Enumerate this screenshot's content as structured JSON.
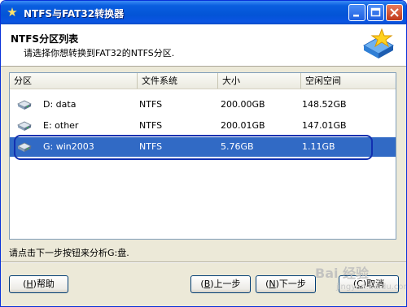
{
  "window": {
    "title": "NTFS与FAT32转换器"
  },
  "header": {
    "title": "NTFS分区列表",
    "subtitle": "请选择你想转换到FAT32的NTFS分区."
  },
  "table": {
    "columns": [
      "分区",
      "文件系统",
      "大小",
      "空闲空间"
    ],
    "rows": [
      {
        "partition": "D: data",
        "fs": "NTFS",
        "size": "200.00GB",
        "free": "148.52GB",
        "selected": false
      },
      {
        "partition": "E: other",
        "fs": "NTFS",
        "size": "200.01GB",
        "free": "147.01GB",
        "selected": false
      },
      {
        "partition": "G: win2003",
        "fs": "NTFS",
        "size": "5.76GB",
        "free": "1.11GB",
        "selected": true
      }
    ]
  },
  "status": {
    "text": "请点击下一步按钮来分析G:盘."
  },
  "buttons": {
    "help": {
      "key": "H",
      "label": "帮助"
    },
    "back": {
      "key": "B",
      "label": "上一步"
    },
    "next": {
      "key": "N",
      "label": "下一步"
    },
    "cancel": {
      "key": "C",
      "label": "取消"
    }
  },
  "watermark": {
    "text": "Bai 经验",
    "sub": "jingyan.baidu.com"
  },
  "colors": {
    "selection": "#316ac5",
    "titlebar": "#0354d6",
    "outline": "#1230b0"
  }
}
